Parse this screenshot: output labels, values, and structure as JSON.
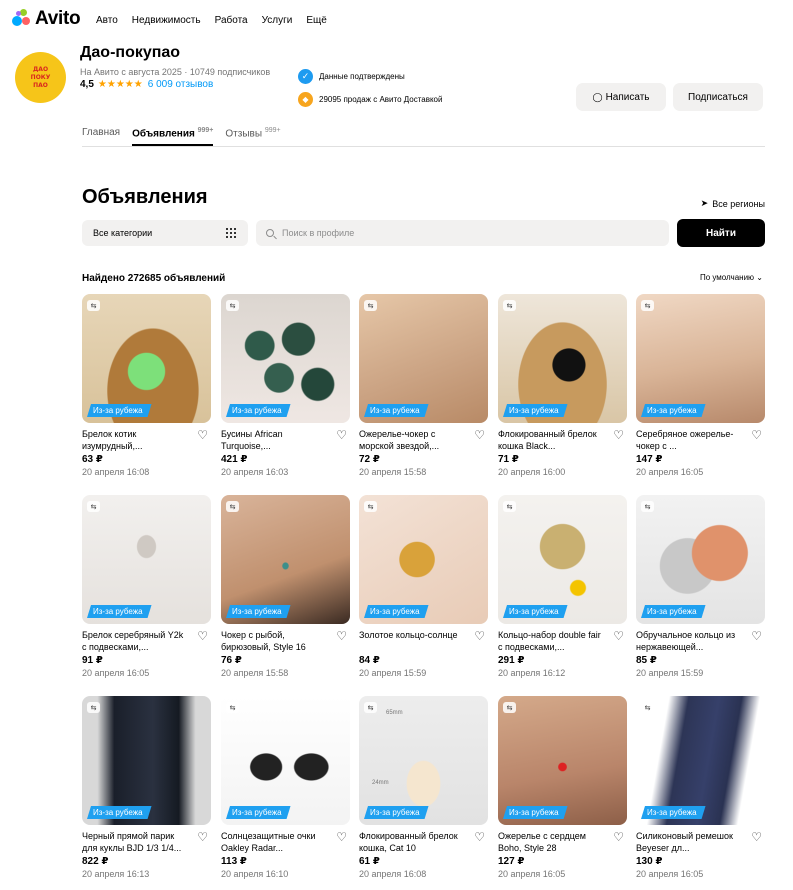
{
  "nav": {
    "logo": "Avito",
    "links": [
      "Авто",
      "Недвижимость",
      "Работа",
      "Услуги",
      "Ещё"
    ]
  },
  "profile": {
    "avatar_text": "ДАО ПОКУ ПАО",
    "name": "Дао-покупао",
    "subtitle": "На Авито с августа 2025 · 10749 подписчиков",
    "rating": "4,5",
    "reviews": "6 009 отзывов",
    "verified": "Данные подтверждены",
    "sales": "29095 продаж с Авито Доставкой",
    "write_button": "Написать",
    "subscribe_button": "Подписаться"
  },
  "tabs": [
    {
      "label": "Главная",
      "count": ""
    },
    {
      "label": "Объявления",
      "count": "999+"
    },
    {
      "label": "Отзывы",
      "count": "999+"
    }
  ],
  "listings": {
    "title": "Объявления",
    "regions": "Все регионы",
    "category": "Все категории",
    "search_placeholder": "Поиск в профиле",
    "find_button": "Найти",
    "found": "Найдено 272685 объявлений",
    "sort": "По умолчанию",
    "badge": "Из-за рубежа"
  },
  "items": [
    {
      "title": "Брелок котик изумрудный,...",
      "price": "63 ₽",
      "date": "20 апреля 16:08"
    },
    {
      "title": "Бусины African Turquoise,...",
      "price": "421 ₽",
      "date": "20 апреля 16:03"
    },
    {
      "title": "Ожерелье-чокер с морской звездой,...",
      "price": "72 ₽",
      "date": "20 апреля 15:58"
    },
    {
      "title": "Флокированный брелок кошка Black...",
      "price": "71 ₽",
      "date": "20 апреля 16:00"
    },
    {
      "title": "Серебряное ожерелье-чокер с ...",
      "price": "147 ₽",
      "date": "20 апреля 16:05"
    },
    {
      "title": "Брелок серебряный Y2k с подвесками,...",
      "price": "91 ₽",
      "date": "20 апреля 16:05"
    },
    {
      "title": "Чокер с рыбой, бирюзовый, Style 16",
      "price": "76 ₽",
      "date": "20 апреля 15:58"
    },
    {
      "title": "Золотое кольцо-солнце",
      "price": "84 ₽",
      "date": "20 апреля 15:59"
    },
    {
      "title": "Кольцо-набор double fair с подвесками,...",
      "price": "291 ₽",
      "date": "20 апреля 16:12"
    },
    {
      "title": "Обручальное кольцо из нержавеющей...",
      "price": "85 ₽",
      "date": "20 апреля 15:59"
    },
    {
      "title": "Черный прямой парик для куклы BJD 1/3 1/4...",
      "price": "822 ₽",
      "date": "20 апреля 16:13"
    },
    {
      "title": "Солнцезащитные очки Oakley Radar...",
      "price": "113 ₽",
      "date": "20 апреля 16:10"
    },
    {
      "title": "Флокированный брелок кошка, Cat 10",
      "price": "61 ₽",
      "date": "20 апреля 16:08"
    },
    {
      "title": "Ожерелье с сердцем Boho, Style 28",
      "price": "127 ₽",
      "date": "20 апреля 16:05"
    },
    {
      "title": "Силиконовый ремешок Beyeser дл...",
      "price": "130 ₽",
      "date": "20 апреля 16:05"
    }
  ],
  "image_labels": {
    "dim_top": "65mm",
    "dim_bottom": "24mm"
  },
  "colors": {
    "accent": "#0099f7",
    "badge": "#1fa0f0",
    "star": "#ffa200",
    "avatar": "#f6c519"
  }
}
